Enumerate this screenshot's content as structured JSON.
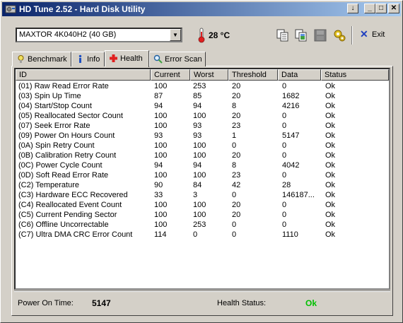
{
  "window": {
    "title": "HD Tune 2.52 - Hard Disk Utility",
    "buttons": {
      "down": "↓",
      "minimize": "_",
      "maximize": "□",
      "close": "✕"
    }
  },
  "toolbar": {
    "drive": "MAXTOR 4K040H2 (40 GB)",
    "temperature": "28 °C",
    "exit_label": "Exit",
    "icons": [
      "copy-text-icon",
      "copy-screenshot-icon",
      "save-icon",
      "options-icon"
    ]
  },
  "tabs": [
    {
      "label": "Benchmark",
      "icon": "benchmark-icon"
    },
    {
      "label": "Info",
      "icon": "info-icon"
    },
    {
      "label": "Health",
      "icon": "health-cross-icon",
      "selected": true
    },
    {
      "label": "Error Scan",
      "icon": "magnifier-icon"
    }
  ],
  "table": {
    "headers": [
      "ID",
      "Current",
      "Worst",
      "Threshold",
      "Data",
      "Status"
    ],
    "rows": [
      [
        "(01) Raw Read Error Rate",
        "100",
        "253",
        "20",
        "0",
        "Ok"
      ],
      [
        "(03) Spin Up Time",
        "87",
        "85",
        "20",
        "1682",
        "Ok"
      ],
      [
        "(04) Start/Stop Count",
        "94",
        "94",
        "8",
        "4216",
        "Ok"
      ],
      [
        "(05) Reallocated Sector Count",
        "100",
        "100",
        "20",
        "0",
        "Ok"
      ],
      [
        "(07) Seek Error Rate",
        "100",
        "93",
        "23",
        "0",
        "Ok"
      ],
      [
        "(09) Power On Hours Count",
        "93",
        "93",
        "1",
        "5147",
        "Ok"
      ],
      [
        "(0A) Spin Retry Count",
        "100",
        "100",
        "0",
        "0",
        "Ok"
      ],
      [
        "(0B) Calibration Retry Count",
        "100",
        "100",
        "20",
        "0",
        "Ok"
      ],
      [
        "(0C) Power Cycle Count",
        "94",
        "94",
        "8",
        "4042",
        "Ok"
      ],
      [
        "(0D) Soft Read Error Rate",
        "100",
        "100",
        "23",
        "0",
        "Ok"
      ],
      [
        "(C2) Temperature",
        "90",
        "84",
        "42",
        "28",
        "Ok"
      ],
      [
        "(C3) Hardware ECC Recovered",
        "33",
        "3",
        "0",
        "146187...",
        "Ok"
      ],
      [
        "(C4) Reallocated Event Count",
        "100",
        "100",
        "20",
        "0",
        "Ok"
      ],
      [
        "(C5) Current Pending Sector",
        "100",
        "100",
        "20",
        "0",
        "Ok"
      ],
      [
        "(C6) Offline Uncorrectable",
        "100",
        "253",
        "0",
        "0",
        "Ok"
      ],
      [
        "(C7) Ultra DMA CRC Error Count",
        "114",
        "0",
        "0",
        "1110",
        "Ok"
      ]
    ]
  },
  "footer": {
    "power_on_label": "Power On Time:",
    "power_on_value": "5147",
    "health_label": "Health Status:",
    "health_value": "Ok"
  },
  "colors": {
    "title_start": "#0a246a",
    "title_end": "#a6caf0",
    "health_ok": "#00c000",
    "exit_icon": "#2040c0"
  }
}
